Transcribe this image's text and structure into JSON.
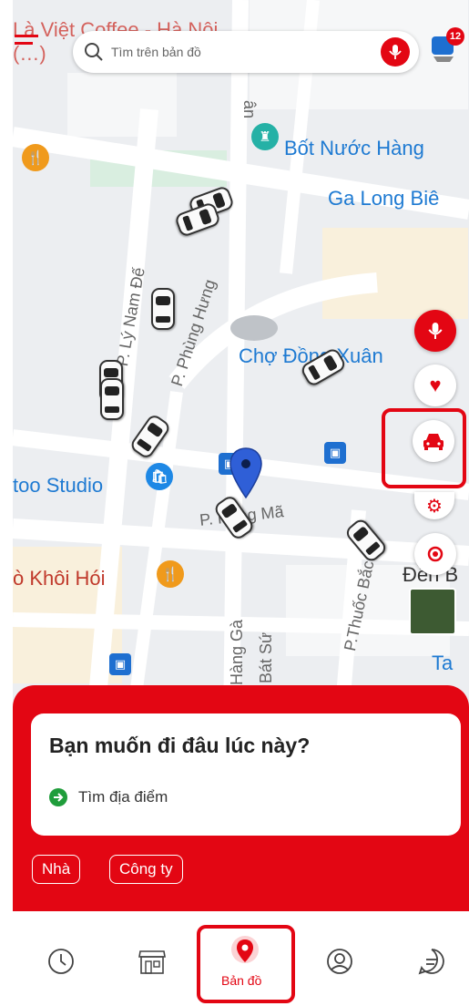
{
  "search": {
    "placeholder": "Tìm trên bản đồ"
  },
  "notifications": {
    "count": "12"
  },
  "map": {
    "top_left_label": "Là Việt Coffee - Hà Nội (…)",
    "places": {
      "bot_nuoc": "Bốt Nước Hàng",
      "ga_long_bien": "Ga Long Biê",
      "cho_dong_xuan": "Chợ Đồng Xuân",
      "studio": "too Studio",
      "khoi_hoi": "ò Khôi Hói",
      "den": "Đền B",
      "ta": "Ta"
    },
    "streets": {
      "ly_nam_de": "P. Lý Nam Đế",
      "phung_hung": "P. Phùng Hưng",
      "hang_ma": "P. Hàng Mã",
      "thuoc_bac": "P.Thuốc Bắc",
      "hang_ga": "Hàng Gà",
      "bat_su": "Bát Sứ",
      "an": "ân"
    }
  },
  "sheet": {
    "title": "Bạn muốn đi đâu lúc này?",
    "find_place": "Tìm địa điểm",
    "chips": [
      "Nhà",
      "Công ty"
    ]
  },
  "nav": {
    "active_label": "Bản đồ"
  },
  "colors": {
    "accent": "#e30613",
    "map_text_blue": "#1e7ad2",
    "go_green": "#1f9d3b"
  }
}
